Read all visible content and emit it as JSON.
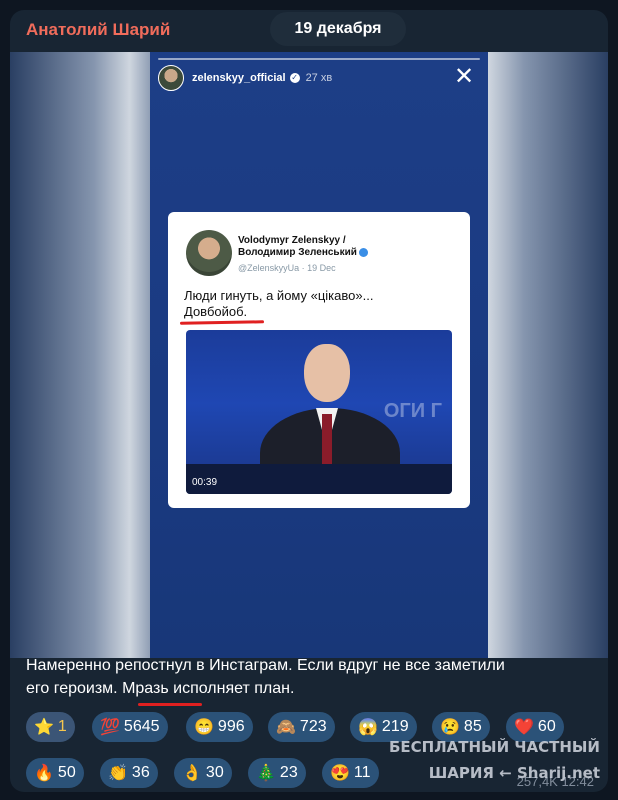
{
  "header": {
    "author": "Анатолий Шарий",
    "date": "19 декабря"
  },
  "story": {
    "username": "zelenskyy_official",
    "time": "27 хв",
    "close_icon": "close-icon",
    "tweet": {
      "name_line1": "Volodymyr Zelenskyy /",
      "name_line2": "Володимир Зеленський",
      "handle": "@ZelenskyyUa · 19 Dec",
      "text_line1": "Люди гинуть, а йому «цікаво»...",
      "text_line2": "Довбойоб.",
      "video_duration": "00:39",
      "video_overlay": "ОГИ Г"
    }
  },
  "caption": {
    "line1": "Намеренно репостнул в Инстаграм. Если вдруг не все заметили",
    "line2": "его героизм. Мразь исполняет план."
  },
  "reactions": [
    {
      "emoji": "⭐",
      "count": "1",
      "own": true
    },
    {
      "emoji": "💯",
      "count": "5645"
    },
    {
      "emoji": "😁",
      "count": "996"
    },
    {
      "emoji": "🙈",
      "count": "723"
    },
    {
      "emoji": "😱",
      "count": "219"
    },
    {
      "emoji": "😢",
      "count": "85"
    },
    {
      "emoji": "❤️",
      "count": "60"
    },
    {
      "emoji": "🔥",
      "count": "50"
    },
    {
      "emoji": "👏",
      "count": "36"
    },
    {
      "emoji": "👌",
      "count": "30"
    },
    {
      "emoji": "🎄",
      "count": "23"
    },
    {
      "emoji": "😍",
      "count": "11"
    }
  ],
  "watermark": {
    "line1": "БЕСПЛАТНЫЙ ЧАСТНЫЙ",
    "line2": "ШАРИЯ ← Sharij.net"
  },
  "meta": "257,4K 12:42"
}
